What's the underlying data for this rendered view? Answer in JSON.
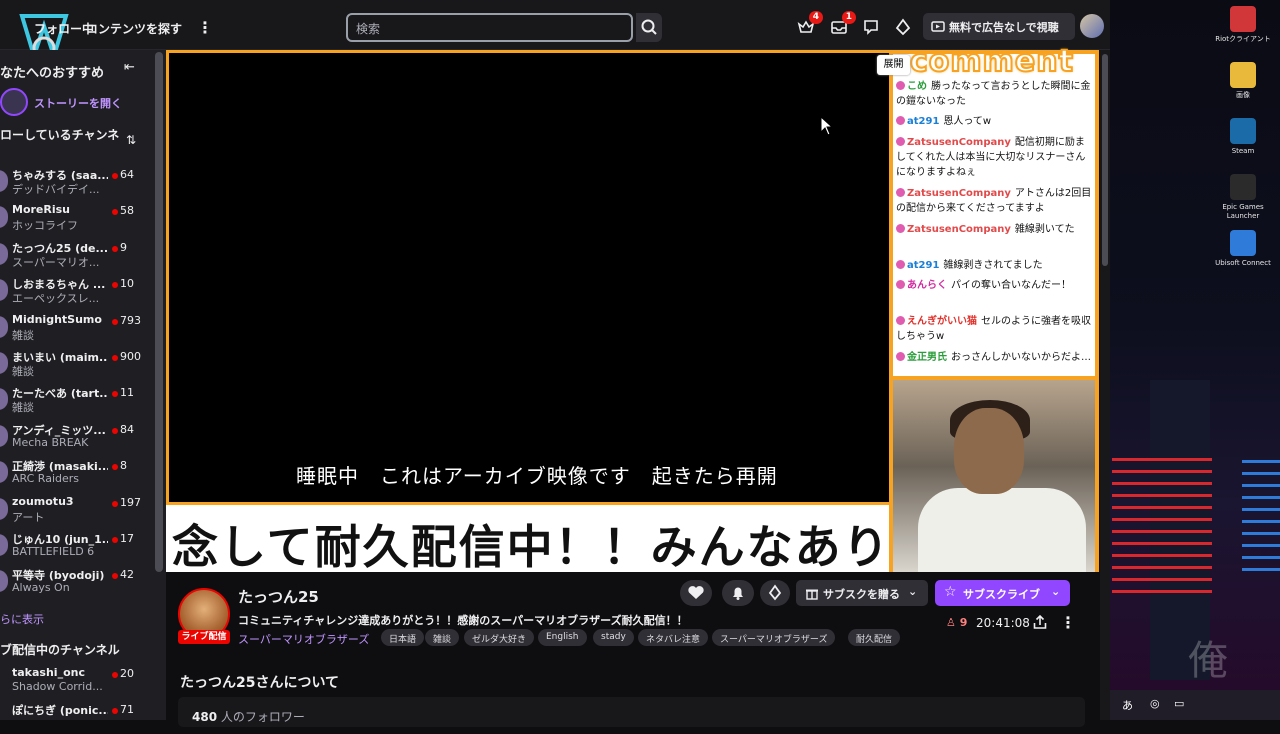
{
  "nav": {
    "tab_following": "フォロー中",
    "tab_browse": "コンテンツを探す",
    "search_placeholder": "検索",
    "badge_prime": "4",
    "badge_inbox": "1",
    "adfree_label": "無料で広告なしで視聴"
  },
  "sidebar": {
    "recommended_title": "なたへのおすすめ",
    "stories_label": "ストーリーを開く",
    "following_title": "ローしているチャンネ",
    "channels": [
      {
        "name": "ちゃみする (saa...",
        "game": "デッドバイデイ...",
        "viewers": "64"
      },
      {
        "name": "MoreRisu",
        "game": "ホッコライフ",
        "viewers": "58"
      },
      {
        "name": "たっつん25 (de...",
        "game": "スーパーマリオ...",
        "viewers": "9"
      },
      {
        "name": "しおまるちゃん ...",
        "game": "エーペックスレ...",
        "viewers": "10"
      },
      {
        "name": "MidnightSumo",
        "game": "雑談",
        "viewers": "793"
      },
      {
        "name": "まいまい (maim...",
        "game": "雑談",
        "viewers": "900"
      },
      {
        "name": "たーたべあ (tart...",
        "game": "雑談",
        "viewers": "11"
      },
      {
        "name": "アンディ_ミッツ...",
        "game": "Mecha BREAK",
        "viewers": "84"
      },
      {
        "name": "正綺渉 (masaki...",
        "game": "ARC Raiders",
        "viewers": "8"
      },
      {
        "name": "zoumotu3",
        "game": "アート",
        "viewers": "197"
      },
      {
        "name": "じゅん10 (jun_1...",
        "game": "BATTLEFIELD 6",
        "viewers": "17"
      },
      {
        "name": "平等寺 (byodoji)",
        "game": "Always On",
        "viewers": "42"
      }
    ],
    "show_more": "らに表示",
    "live_title": "ブ配信中のチャンネル",
    "live_channels": [
      {
        "name": "takashi_onc",
        "game": "Shadow Corrid...",
        "viewers": "20"
      },
      {
        "name": "ぽにちぎ (ponic...",
        "game": "",
        "viewers": "71"
      }
    ]
  },
  "player": {
    "sleep_text": "睡眠中　これはアーカイブ映像です　起きたら再開",
    "ticker_text": "念して耐久配信中！！みんなあり",
    "comment_title": "comment",
    "expand_label": "展開",
    "comments": [
      {
        "user": "こめ",
        "text": "勝ったなって言おうとした瞬間に金の鎧ないなった",
        "color": "#2a9d3b"
      },
      {
        "user": "at291",
        "text": "恩人ってw",
        "color": "#1a7fd6"
      },
      {
        "user": "ZatsusenCompany",
        "text": "配信初期に励ましてくれた人は本当に大切なリスナーさんになりますよねぇ",
        "color": "#e04a4a"
      },
      {
        "user": "ZatsusenCompany",
        "text": "アトさんは2回目の配信から来てくださってますよ",
        "color": "#e04a4a"
      },
      {
        "user": "ZatsusenCompany",
        "text": "雑線剥いてた",
        "color": "#e04a4a"
      },
      {
        "user": "at291",
        "text": "雑線剥きされてました",
        "color": "#1a7fd6"
      },
      {
        "user": "あんらく",
        "text": "パイの奪い合いなんだー！",
        "color": "#d42aa0"
      },
      {
        "user": "えんぎがいい猫",
        "text": "セルのように強者を吸収しちゃうw",
        "color": "#e0302a"
      },
      {
        "user": "金正男氏",
        "text": "おっさんしかいないからだよ…",
        "color": "#2a9d3b"
      }
    ]
  },
  "stream": {
    "channel_name": "たっつん25",
    "live_badge": "ライブ配信",
    "title": "コミュニティチャレンジ達成ありがとう！！感謝のスーパーマリオブラザーズ耐久配信！！",
    "category": "スーパーマリオブラザーズ",
    "tags": [
      "日本語",
      "雑談",
      "ゼルダ大好き",
      "English",
      "stady",
      "ネタバレ注意",
      "スーパーマリオブラザーズ",
      "耐久配信"
    ],
    "gift_label": "サブスクを贈る",
    "subscribe_label": "サブスクライブ",
    "viewers": "9",
    "uptime": "20:41:08",
    "about_title": "たっつん25さんについて",
    "followers_count": "480",
    "followers_label": "人のフォロワー"
  },
  "desktop": {
    "icons": [
      {
        "label": "Riotクライアント",
        "color": "#d13639"
      },
      {
        "label": "画像",
        "color": "#e8b93a"
      },
      {
        "label": "Steam",
        "color": "#1b6ba8"
      },
      {
        "label": "Epic Games Launcher",
        "color": "#2b2b2b"
      },
      {
        "label": "Ubisoft Connect",
        "color": "#2f7bd9"
      }
    ],
    "ime": "あ"
  }
}
